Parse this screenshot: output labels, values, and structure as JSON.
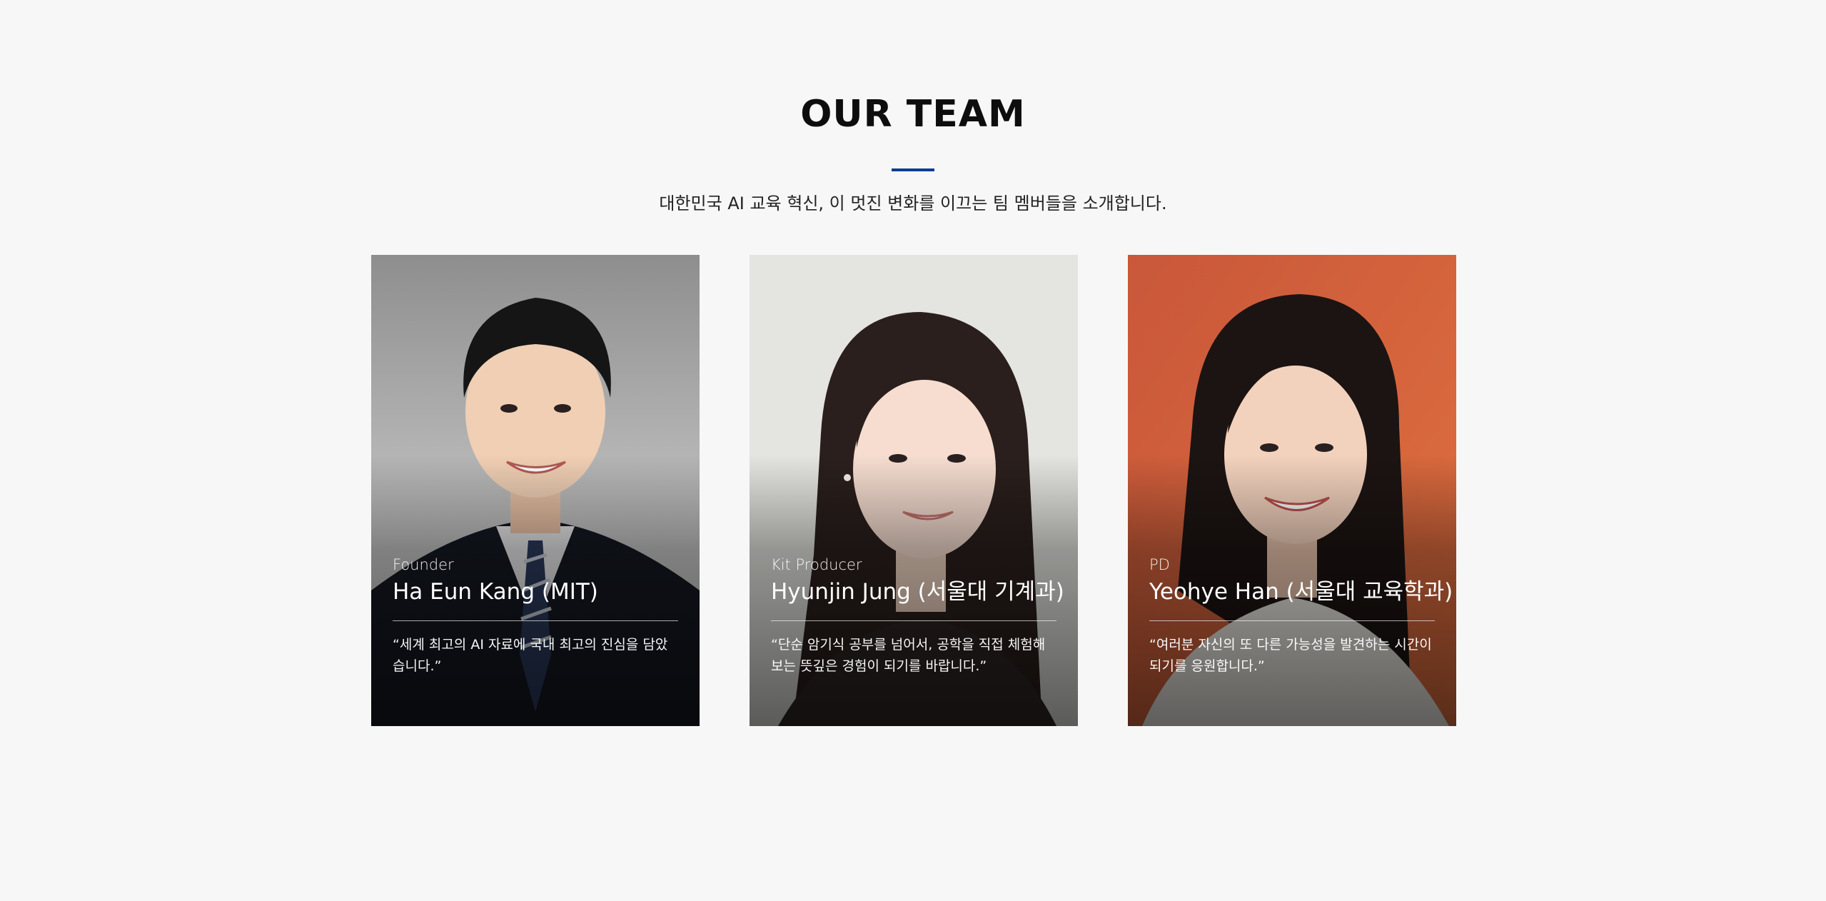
{
  "section": {
    "title": "OUR TEAM",
    "subtitle": "대한민국 AI 교육 혁신, 이 멋진 변화를 이끄는 팀 멤버들을 소개합니다.",
    "accent_color": "#0a3d91"
  },
  "team": [
    {
      "role": "Founder",
      "name": "Ha Eun Kang (MIT)",
      "quote": "“세계 최고의 AI 자료에 국내 최고의 진심을 담았습니다.”",
      "photo_bg": "#9a9a9a"
    },
    {
      "role": "Kit Producer",
      "name": "Hyunjin Jung (서울대 기계과)",
      "quote": "“단순 암기식 공부를 넘어서, 공학을 직접 체험해보는 뜻깊은 경험이 되기를 바랍니다.”",
      "photo_bg": "#e6e6e3"
    },
    {
      "role": "PD",
      "name": "Yeohye Han (서울대 교육학과)",
      "quote": "“여러분 자신의 또 다른 가능성을 발견하는 시간이 되기를 응원합니다.”",
      "photo_bg": "#d9623c"
    }
  ]
}
